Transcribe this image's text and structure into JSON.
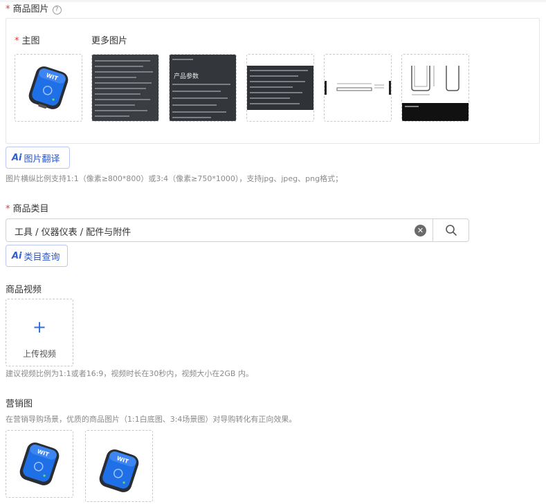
{
  "images_section": {
    "title": "商品图片",
    "main_label": "主图",
    "more_label": "更多图片",
    "main_image_icon": "product-sensor-icon",
    "more_images": [
      {
        "name": "spec-table-image-1"
      },
      {
        "name": "spec-table-image-2",
        "title": "产品参数"
      },
      {
        "name": "spec-table-image-3"
      },
      {
        "name": "dimension-drawing-image-1"
      },
      {
        "name": "dimension-drawing-image-2"
      }
    ],
    "ai_translate_label": "图片翻译",
    "hint": "图片横纵比例支持1:1（像素≥800*800）或3:4（像素≥750*1000），支持jpg、jpeg、png格式；"
  },
  "category_section": {
    "title": "商品类目",
    "value": "工具 / 仪器仪表 / 配件与附件",
    "ai_query_label": "类目查询"
  },
  "video_section": {
    "title": "商品视频",
    "upload_label": "上传视频",
    "hint": "建议视频比例为1:1或者16:9，视频时长在30秒内，视频大小在2GB 内。"
  },
  "marketing_section": {
    "title": "营销图",
    "hint": "在营销导购场景，优质的商品图片（1:1白底图、3:4场景图）对导购转化有正向效果。"
  },
  "ai_badge": "Ai",
  "colors": {
    "required": "#e4393c",
    "accent": "#2f6fe0",
    "device_blue": "#1f6fe6"
  }
}
